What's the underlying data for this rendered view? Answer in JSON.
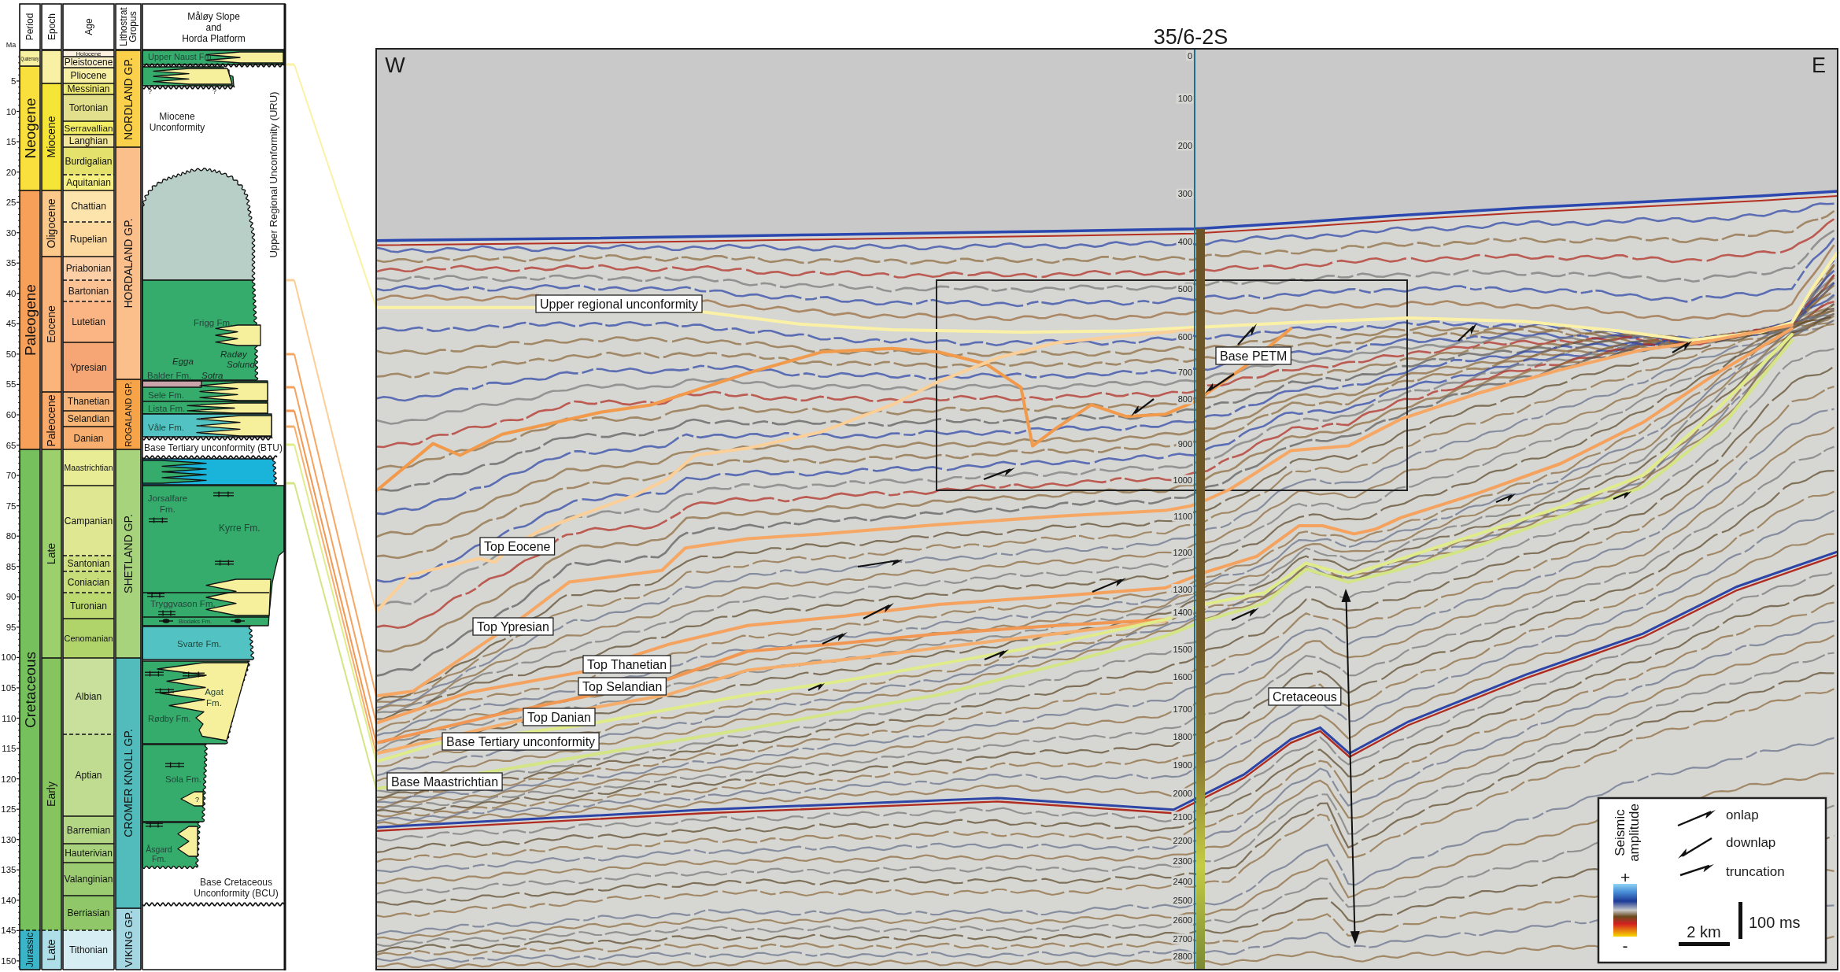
{
  "stratigraphic_column": {
    "headers": [
      {
        "lines": [
          "Period"
        ]
      },
      {
        "lines": [
          "Epoch"
        ]
      },
      {
        "lines": [
          "Age"
        ]
      },
      {
        "lines": [
          "Lithostrat",
          "Gropus"
        ]
      },
      {
        "lines": [
          "Måløy Slope",
          "and",
          "Horda Platform"
        ]
      }
    ],
    "ma_unit": "Ma",
    "ma_ticks": [
      "5",
      "10",
      "15",
      "20",
      "25",
      "30",
      "35",
      "40",
      "45",
      "50",
      "55",
      "60",
      "65",
      "70",
      "75",
      "80",
      "85",
      "90",
      "95",
      "100",
      "105",
      "110",
      "115",
      "120",
      "125",
      "130",
      "135",
      "140",
      "145",
      "150"
    ],
    "periods": [
      {
        "label": "Quaternary",
        "color": "#f6f0a0",
        "dashed_top": false
      },
      {
        "label": "Neogene",
        "color": "#f9e03c",
        "dashed_top": false
      },
      {
        "label": "Paleogene",
        "color": "#f6a05a",
        "dashed_top": false
      },
      {
        "label": "Cretaceous",
        "color": "#76c15e",
        "dashed_top": false
      },
      {
        "label": "Jurassic",
        "color": "#3bb4c8",
        "dashed_top": true
      }
    ],
    "epochs": [
      {
        "color": "#f8f0a4",
        "dashed_top": false
      },
      {
        "label": "Miocene",
        "color": "#f5e536",
        "dashed_top": false
      },
      {
        "label": "Oligocene",
        "color": "#fcc98a",
        "dashed_top": false
      },
      {
        "label": "Eocene",
        "color": "#fbb57a",
        "dashed_top": false
      },
      {
        "label": "Paleocene",
        "color": "#fbaa6a",
        "dashed_top": false
      },
      {
        "label": "Late",
        "color": "#9bd06d",
        "dashed_top": false
      },
      {
        "label": "Early",
        "color": "#86c45f",
        "dashed_top": false
      },
      {
        "label": "Late",
        "color": "#aedfe8",
        "dashed_top": true
      }
    ],
    "ages": [
      {
        "label": "Holocene",
        "color": "#fdf3e0",
        "dashed_top": false
      },
      {
        "label": "Pleistocene",
        "color": "#fbf1c8",
        "dashed_top": false
      },
      {
        "label": "Pliocene",
        "color": "#f7efa2",
        "dashed_top": false
      },
      {
        "label": "Messinian",
        "color": "#eeea72",
        "dashed_top": false
      },
      {
        "label": "Tortonian",
        "color": "#e2e08c",
        "dashed_top": false
      },
      {
        "label": "Serravallian",
        "color": "#f4ee64",
        "dashed_top": false
      },
      {
        "label": "Langhian",
        "color": "#f2e69a",
        "dashed_top": false
      },
      {
        "label": "Burdigalian",
        "color": "#e4e26c",
        "dashed_top": false
      },
      {
        "label": "Aquitanian",
        "color": "#f6f080",
        "dashed_top": true
      },
      {
        "label": "Chattian",
        "color": "#fde4ad",
        "dashed_top": false
      },
      {
        "label": "Rupelian",
        "color": "#fdd9a0",
        "dashed_top": true
      },
      {
        "label": "Priabonian",
        "color": "#fccfa6",
        "dashed_top": false
      },
      {
        "label": "Bartonian",
        "color": "#fcc293",
        "dashed_top": true
      },
      {
        "label": "Lutetian",
        "color": "#fbb584",
        "dashed_top": true
      },
      {
        "label": "Ypresian",
        "color": "#f6a675",
        "dashed_top": false
      },
      {
        "label": "Thanetian",
        "color": "#f8b57a",
        "dashed_top": false
      },
      {
        "label": "Selandian",
        "color": "#f8b676",
        "dashed_top": false
      },
      {
        "label": "Danian",
        "color": "#f7ae6e",
        "dashed_top": false
      },
      {
        "label": "Maastrichtian",
        "color": "#e8ec95",
        "dashed_top": false
      },
      {
        "label": "Campanian",
        "color": "#dfe792",
        "dashed_top": false
      },
      {
        "label": "Santonian",
        "color": "#d2e283",
        "dashed_top": true
      },
      {
        "label": "Coniacian",
        "color": "#c6dd7a",
        "dashed_top": true
      },
      {
        "label": "Turonian",
        "color": "#bcd96f",
        "dashed_top": true
      },
      {
        "label": "Cenomanian",
        "color": "#b1d46a",
        "dashed_top": false
      },
      {
        "label": "Albian",
        "color": "#c8e09c",
        "dashed_top": false
      },
      {
        "label": "Aptian",
        "color": "#bfdc90",
        "dashed_top": true
      },
      {
        "label": "Barremian",
        "color": "#b3d685",
        "dashed_top": false
      },
      {
        "label": "Hauterivian",
        "color": "#a8d27c",
        "dashed_top": false
      },
      {
        "label": "Valanginian",
        "color": "#9ccc72",
        "dashed_top": false
      },
      {
        "label": "Berriasian",
        "color": "#90c768",
        "dashed_top": false
      },
      {
        "label": "Tithonian",
        "color": "#d6eef3",
        "dashed_top": true
      }
    ],
    "groups": [
      {
        "label": "NORDLAND GP.",
        "color": "#fbd04a"
      },
      {
        "label": "HORDALAND GP.",
        "color": "#fbbf8c"
      },
      {
        "label": "ROGALAND GP.",
        "color": "#f7a347"
      },
      {
        "label": "SHETLAND GP.",
        "color": "#a7d37c"
      },
      {
        "label": "CROMER KNOLL GP.",
        "color": "#52bcbc"
      },
      {
        "label": "VIKING GP.",
        "color": "#a4d7e2"
      }
    ],
    "lithology_labels": [
      {
        "lines": [
          "Upper Naust Fm."
        ],
        "kind": "formation"
      },
      {
        "lines": [
          "?"
        ],
        "kind": "query"
      },
      {
        "lines": [
          "?"
        ],
        "kind": "query"
      },
      {
        "lines": [
          "Miocene",
          "Unconformity"
        ],
        "kind": "unconformity"
      },
      {
        "lines": [
          "Upper Regional Unconformity (URU)"
        ],
        "kind": "unconformity"
      },
      {
        "lines": [
          "Frigg Fm."
        ],
        "kind": "formation"
      },
      {
        "lines": [
          "Egga"
        ],
        "kind": "sand_unit"
      },
      {
        "lines": [
          "Radøy"
        ],
        "kind": "sand_unit"
      },
      {
        "lines": [
          "Solund"
        ],
        "kind": "sand_unit"
      },
      {
        "lines": [
          "Sotra"
        ],
        "kind": "sand_unit"
      },
      {
        "lines": [
          "Balder Fm."
        ],
        "kind": "formation"
      },
      {
        "lines": [
          "Sele Fm."
        ],
        "kind": "formation"
      },
      {
        "lines": [
          "Lista Fm."
        ],
        "kind": "formation"
      },
      {
        "lines": [
          "Våle Fm."
        ],
        "kind": "formation"
      },
      {
        "lines": [
          "Base Tertiary unconformity (BTU)"
        ],
        "kind": "unconformity"
      },
      {
        "lines": [
          "Jorsalfare",
          "Fm."
        ],
        "kind": "formation"
      },
      {
        "lines": [
          "Kyrre Fm."
        ],
        "kind": "formation"
      },
      {
        "lines": [
          "Tryggvason Fm."
        ],
        "kind": "formation"
      },
      {
        "lines": [
          "Blodøks Fm."
        ],
        "kind": "formation"
      },
      {
        "lines": [
          "Svarte Fm."
        ],
        "kind": "formation"
      },
      {
        "lines": [
          "Agat",
          "Fm."
        ],
        "kind": "formation"
      },
      {
        "lines": [
          "Rødby Fm."
        ],
        "kind": "formation"
      },
      {
        "lines": [
          "Sola Fm."
        ],
        "kind": "formation"
      },
      {
        "lines": [
          "?"
        ],
        "kind": "query"
      },
      {
        "lines": [
          "Åsgard",
          "Fm."
        ],
        "kind": "formation"
      },
      {
        "lines": [
          "Base Cretaceous",
          "Unconformity (BCU)"
        ],
        "kind": "unconformity"
      }
    ]
  },
  "seismic_section": {
    "well": "35/6-2S",
    "directions": [
      "W",
      "E"
    ],
    "time_labels": [
      "0",
      "100",
      "200",
      "300",
      "400",
      "500",
      "600",
      "700",
      "800",
      "900",
      "1000",
      "1100",
      "1200",
      "1300",
      "1400",
      "1500",
      "1600",
      "1700",
      "1800",
      "1900",
      "2000",
      "2100",
      "2200",
      "2300",
      "2400",
      "2500",
      "2600",
      "2700",
      "2800"
    ],
    "horizons": [
      {
        "label": "Upper regional unconformity",
        "color": "#fbf1a6"
      },
      {
        "label": "Base PETM",
        "color": "#f19a4c"
      },
      {
        "label": "Top Eocene",
        "color": "#fbcf98"
      },
      {
        "label": "Top Ypresian",
        "color": "#f6a764"
      },
      {
        "label": "Top Thanetian",
        "color": "#f4a25e"
      },
      {
        "label": "Top Selandian",
        "color": "#f19752"
      },
      {
        "label": "Top Danian",
        "color": "#f5ad6c"
      },
      {
        "label": "Base Tertiary unconformity",
        "color": "#e0ec8a"
      },
      {
        "label": "Base Maastrichtian",
        "color": "#d3e584"
      }
    ],
    "annotations": [
      {
        "label": "Cretaceous"
      }
    ],
    "legend": {
      "title_lines": [
        "Seismic",
        "amplitude"
      ],
      "max_sign": "+",
      "min_sign": "-",
      "terminations": [
        {
          "label": "onlap",
          "kind": "onlap"
        },
        {
          "label": "downlap",
          "kind": "downlap"
        },
        {
          "label": "truncation",
          "kind": "truncation"
        }
      ],
      "horizontal_scale": "2 km",
      "vertical_scale": "100 ms"
    }
  }
}
